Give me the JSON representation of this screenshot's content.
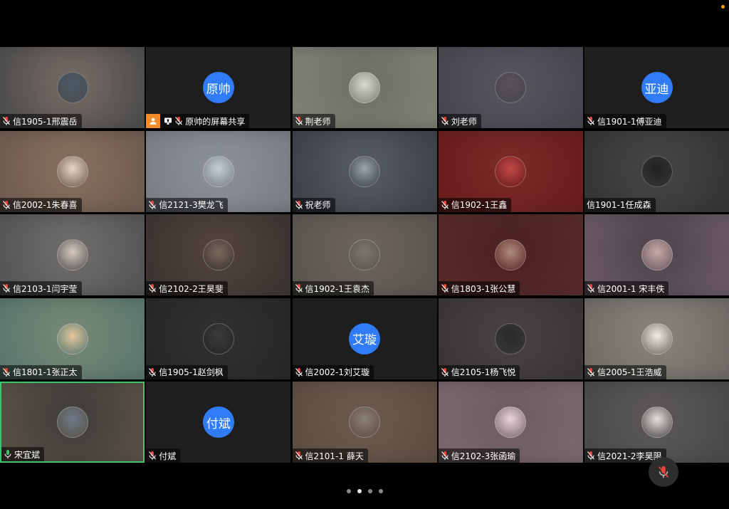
{
  "tiles": [
    {
      "name": "信1905-1邢震岳",
      "avatar": "photo",
      "bg": "#4c4c4c",
      "bg2": "#7d6f68",
      "av": "#4a5a68",
      "mic": "muted"
    },
    {
      "name": "原帅的屏幕共享",
      "avatar": "text",
      "avatar_text": "原帅",
      "bg": "#1e1e1e",
      "bg2": "#1e1e1e",
      "mic": "muted",
      "sharing": true
    },
    {
      "name": "荆老师",
      "avatar": "photo",
      "bg": "#7f8276",
      "bg2": "#6b6d64",
      "av": "#d8d9cf",
      "mic": "muted"
    },
    {
      "name": "刘老师",
      "avatar": "photo",
      "bg": "#47474f",
      "bg2": "#5a5560",
      "av": "#5a5058",
      "mic": "muted"
    },
    {
      "name": "信1901-1傅亚迪",
      "avatar": "text",
      "avatar_text": "亚迪",
      "bg": "#1e1e1e",
      "bg2": "#1e1e1e",
      "mic": "muted"
    },
    {
      "name": "信2002-1朱春喜",
      "avatar": "photo",
      "bg": "#6f5c50",
      "bg2": "#8a7260",
      "av": "#e7d7c7",
      "mic": "muted"
    },
    {
      "name": "信2121-3樊龙飞",
      "avatar": "photo",
      "bg": "#7a7f86",
      "bg2": "#8d939b",
      "av": "#c7ced6",
      "mic": "muted"
    },
    {
      "name": "祝老师",
      "avatar": "photo",
      "bg": "#3c4148",
      "bg2": "#5a6068",
      "av": "#9aa4aa",
      "mic": "muted"
    },
    {
      "name": "信1902-1王鑫",
      "avatar": "photo",
      "bg": "#6a1c1c",
      "bg2": "#7e2a2a",
      "av": "#c24848",
      "mic": "muted"
    },
    {
      "name": "信1901-1任成森",
      "avatar": "photo",
      "bg": "#353535",
      "bg2": "#4a4646",
      "av": "#222222",
      "mic": "none"
    },
    {
      "name": "信2103-1闫宇莹",
      "avatar": "photo",
      "bg": "#555555",
      "bg2": "#747070",
      "av": "#d6c9bd",
      "mic": "muted"
    },
    {
      "name": "信2102-2王昊斐",
      "avatar": "photo",
      "bg": "#3b3430",
      "bg2": "#54463e",
      "av": "#7b6a5d",
      "mic": "muted"
    },
    {
      "name": "信1902-1王袁杰",
      "avatar": "photo",
      "bg": "#5a554f",
      "bg2": "#6e665f",
      "av": "#7d7771",
      "mic": "muted"
    },
    {
      "name": "信1803-1张公慧",
      "avatar": "photo",
      "bg": "#5a2a2a",
      "bg2": "#4a2020",
      "av": "#b08a7a",
      "mic": "muted"
    },
    {
      "name": "信2001-1 宋丰佚",
      "avatar": "photo",
      "bg": "#6a5a64",
      "bg2": "#4a4048",
      "av": "#c7a9a4",
      "mic": "muted"
    },
    {
      "name": "信1801-1张正太",
      "avatar": "photo",
      "bg": "#5a7870",
      "bg2": "#7a8a74",
      "av": "#e2c79e",
      "mic": "muted"
    },
    {
      "name": "信1905-1赵剑枫",
      "avatar": "photo",
      "bg": "#262626",
      "bg2": "#323232",
      "av": "#3b3b3b",
      "mic": "muted"
    },
    {
      "name": "信2002-1刘艾璇",
      "avatar": "text",
      "avatar_text": "艾璇",
      "bg": "#1e1e1e",
      "bg2": "#1e1e1e",
      "mic": "muted"
    },
    {
      "name": "信2105-1杨飞悦",
      "avatar": "photo",
      "bg": "#3a3636",
      "bg2": "#4a4444",
      "av": "#2a2a2a",
      "mic": "muted"
    },
    {
      "name": "信2005-1王浩威",
      "avatar": "photo",
      "bg": "#6f6c66",
      "bg2": "#8a8680",
      "av": "#f0ede6",
      "mic": "muted"
    },
    {
      "name": "宋宜斌",
      "avatar": "photo",
      "bg": "#595146",
      "bg2": "#3b3a38",
      "av": "#6d7b8a",
      "mic": "on",
      "active": true
    },
    {
      "name": "付斌",
      "avatar": "text",
      "avatar_text": "付斌",
      "bg": "#1e1e1e",
      "bg2": "#1e1e1e",
      "mic": "muted"
    },
    {
      "name": "信2101-1 薛天",
      "avatar": "photo",
      "bg": "#5d4c40",
      "bg2": "#6e5c50",
      "av": "#8a8178",
      "mic": "muted"
    },
    {
      "name": "信2102-3张函瑜",
      "avatar": "photo",
      "bg": "#7a6870",
      "bg2": "#6b5a60",
      "av": "#ead4da",
      "mic": "muted"
    },
    {
      "name": "信2021-2李昊限",
      "avatar": "photo",
      "bg": "#4a4a4a",
      "bg2": "#5e5959",
      "av": "#e7dfdc",
      "mic": "muted"
    }
  ],
  "pager": {
    "count": 4,
    "current": 1
  },
  "colors": {
    "accent": "#2f7cf6",
    "active_border": "#3ec46d",
    "share_badge": "#f08c2c",
    "muted_mic": "#e8453c"
  }
}
